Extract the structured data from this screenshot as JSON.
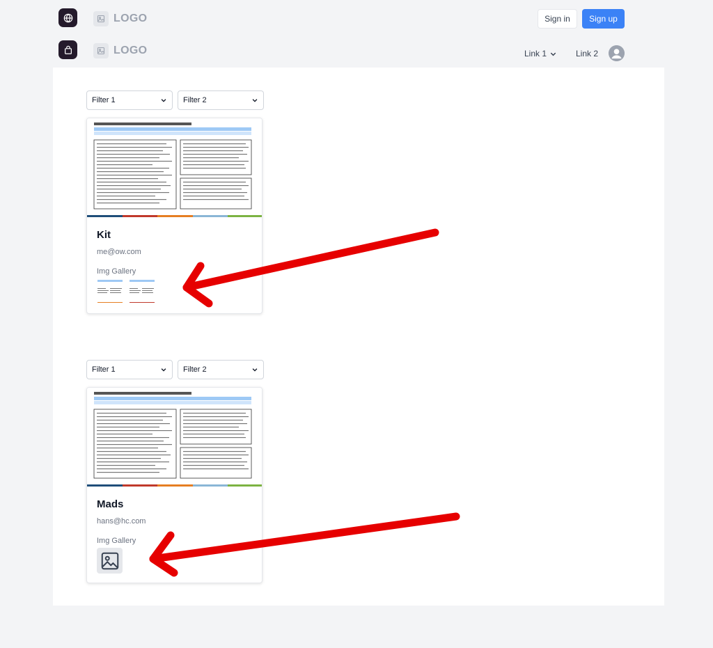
{
  "header": {
    "logo_text": "LOGO",
    "sign_in": "Sign in",
    "sign_up": "Sign up",
    "link1": "Link 1",
    "link2": "Link 2"
  },
  "sections": [
    {
      "filter1": "Filter 1",
      "filter2": "Filter 2",
      "card": {
        "name": "Kit",
        "email": "me@ow.com",
        "gallery_label": "Img Gallery"
      }
    },
    {
      "filter1": "Filter 1",
      "filter2": "Filter 2",
      "card": {
        "name": "Mads",
        "email": "hans@hc.com",
        "gallery_label": "Img Gallery"
      }
    }
  ],
  "colors": {
    "accent": "#3b82f6",
    "nav_icon_bg": "#241a2b",
    "annotation_arrow": "#e60000"
  }
}
